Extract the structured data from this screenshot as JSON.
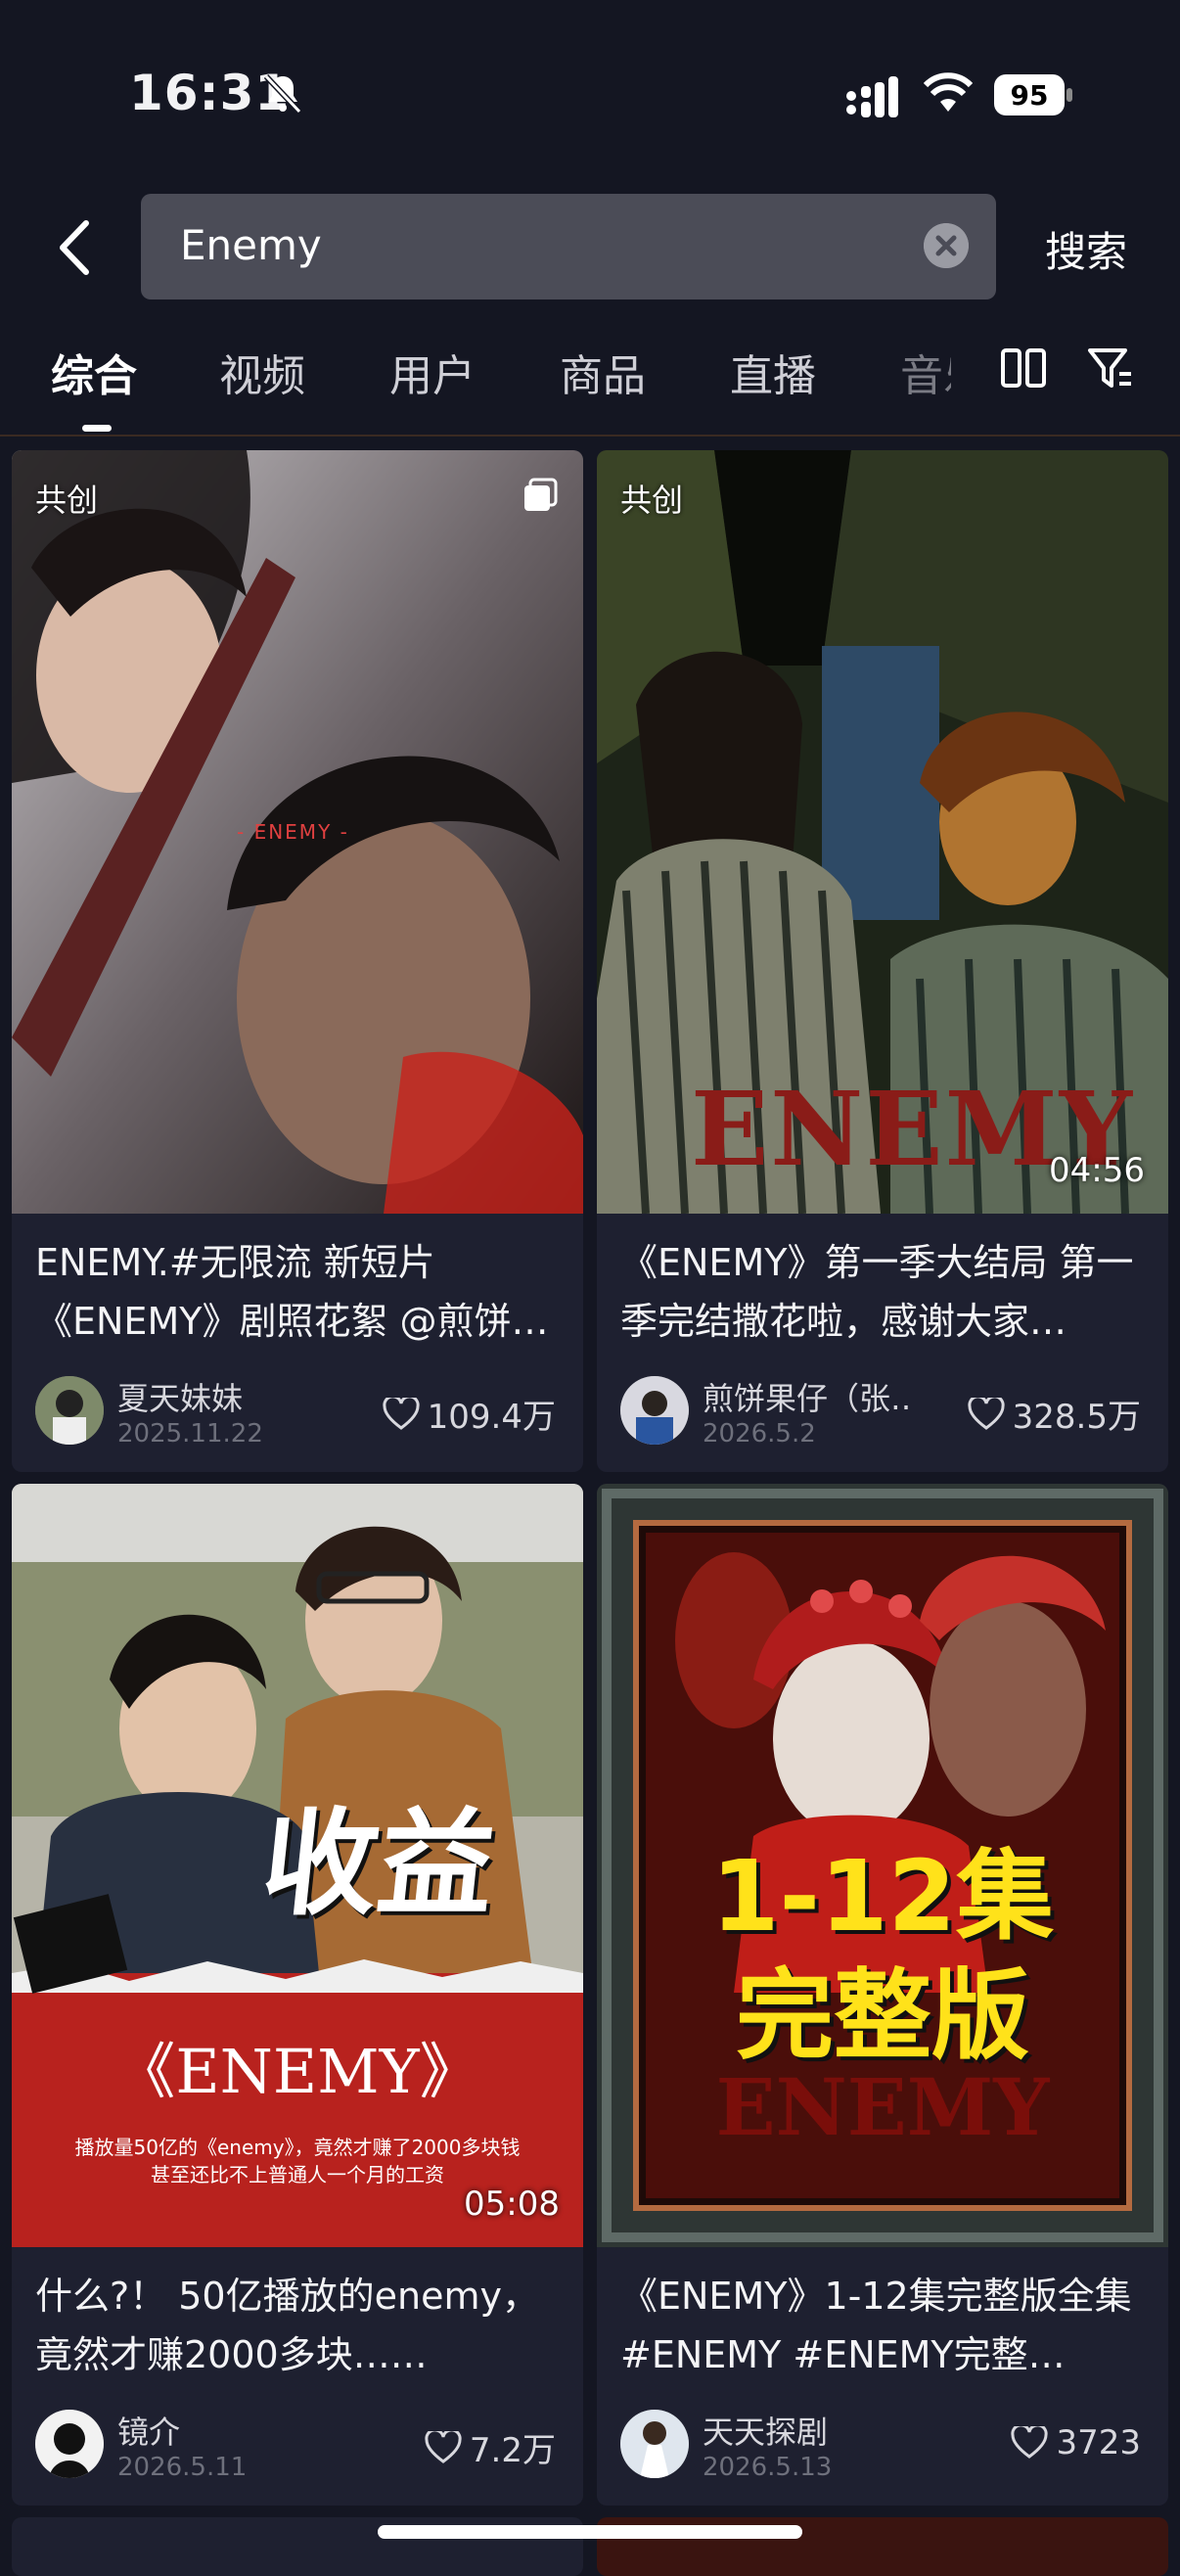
{
  "status_bar": {
    "time": "16:31",
    "battery": "95"
  },
  "search": {
    "query": "Enemy",
    "submit_label": "搜索"
  },
  "tabs": [
    {
      "label": "综合",
      "active": true
    },
    {
      "label": "视频"
    },
    {
      "label": "用户"
    },
    {
      "label": "商品"
    },
    {
      "label": "直播"
    },
    {
      "label": "音乐"
    }
  ],
  "icons": {
    "back": "chevron-left-icon",
    "clear": "clear-icon",
    "layout": "double-column-icon",
    "filter": "filter-icon",
    "like": "heart-icon",
    "mute": "bell-off-icon"
  },
  "cards": [
    {
      "badge": "共创",
      "thumb_text": "- ENEMY -",
      "title": "ENEMY.#无限流 新短片《ENEMY》剧照花絮 @煎饼果…",
      "author": "夏天妹妹",
      "date": "2025.11.22",
      "likes": "109.4万"
    },
    {
      "badge": "共创",
      "duration": "04:56",
      "thumb_text": "ENEMY",
      "title": "《ENEMY》第一季大结局 第一季完结撒花啦，感谢大家…",
      "author": "煎饼果仔（张…",
      "date": "2026.5.2",
      "likes": "328.5万"
    },
    {
      "duration": "05:08",
      "thumb_big": "收益",
      "thumb_text": "《ENEMY》",
      "thumb_caption_1": "播放量50亿的《enemy》，竟然才赚了2000多块钱",
      "thumb_caption_2": "甚至还比不上普通人一个月的工资",
      "title": "什么?！ 50亿播放的enemy，竟然才赚2000多块……",
      "author": "镜介",
      "date": "2026.5.11",
      "likes": "7.2万"
    },
    {
      "thumb_big_1": "1-12集",
      "thumb_big_2": "完整版",
      "thumb_text": "ENEMY",
      "title": "《ENEMY》1-12集完整版全集#ENEMY #ENEMY完整…",
      "author": "天天探剧",
      "date": "2026.5.13",
      "likes": "3723"
    }
  ],
  "colors": {
    "background": "#141622",
    "card": "#1e2030",
    "search_box": "#4b4c57"
  }
}
